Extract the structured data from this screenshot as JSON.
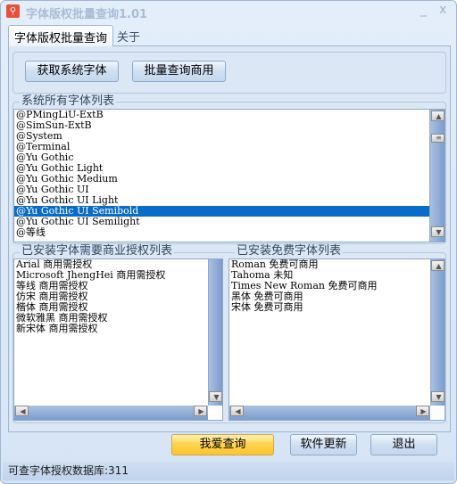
{
  "window": {
    "title": "字体版权批量查询1.01",
    "minimize": "_",
    "close": "x",
    "icon": "magnifier-icon"
  },
  "tabs": [
    {
      "label": "字体版权批量查询",
      "active": true
    },
    {
      "label": "关于",
      "active": false
    }
  ],
  "toolbar": {
    "get_fonts": "获取系统字体",
    "batch_query": "批量查询商用"
  },
  "system_fonts": {
    "legend": "系统所有字体列表",
    "items": [
      "@PMingLiU-ExtB",
      "@SimSun-ExtB",
      "@System",
      "@Terminal",
      "@Yu Gothic",
      "@Yu Gothic Light",
      "@Yu Gothic Medium",
      "@Yu Gothic UI",
      "@Yu Gothic UI Light",
      "@Yu Gothic UI Semibold",
      "@Yu Gothic UI Semilight",
      "@等线"
    ],
    "selected": "@Yu Gothic UI Semibold"
  },
  "commercial": {
    "legend": "已安装字体需要商业授权列表",
    "items": [
      "Arial 商用需授权",
      "Microsoft JhengHei 商用需授权",
      "等线 商用需授权",
      "仿宋 商用需授权",
      "楷体 商用需授权",
      "微软雅黑 商用需授权",
      "新宋体 商用需授权"
    ]
  },
  "free": {
    "legend": "已安装免费字体列表",
    "items": [
      "Roman 免费可商用",
      "Tahoma 未知",
      "Times New Roman 免费可商用",
      "黑体 免费可商用",
      "宋体 免费可商用"
    ]
  },
  "buttons": {
    "query": "我爱查询",
    "update": "软件更新",
    "exit": "退出"
  },
  "status": "可查字体授权数据库:311",
  "colors": {
    "selection": "#0a6cc8",
    "accent_button": "#ffd24a"
  }
}
